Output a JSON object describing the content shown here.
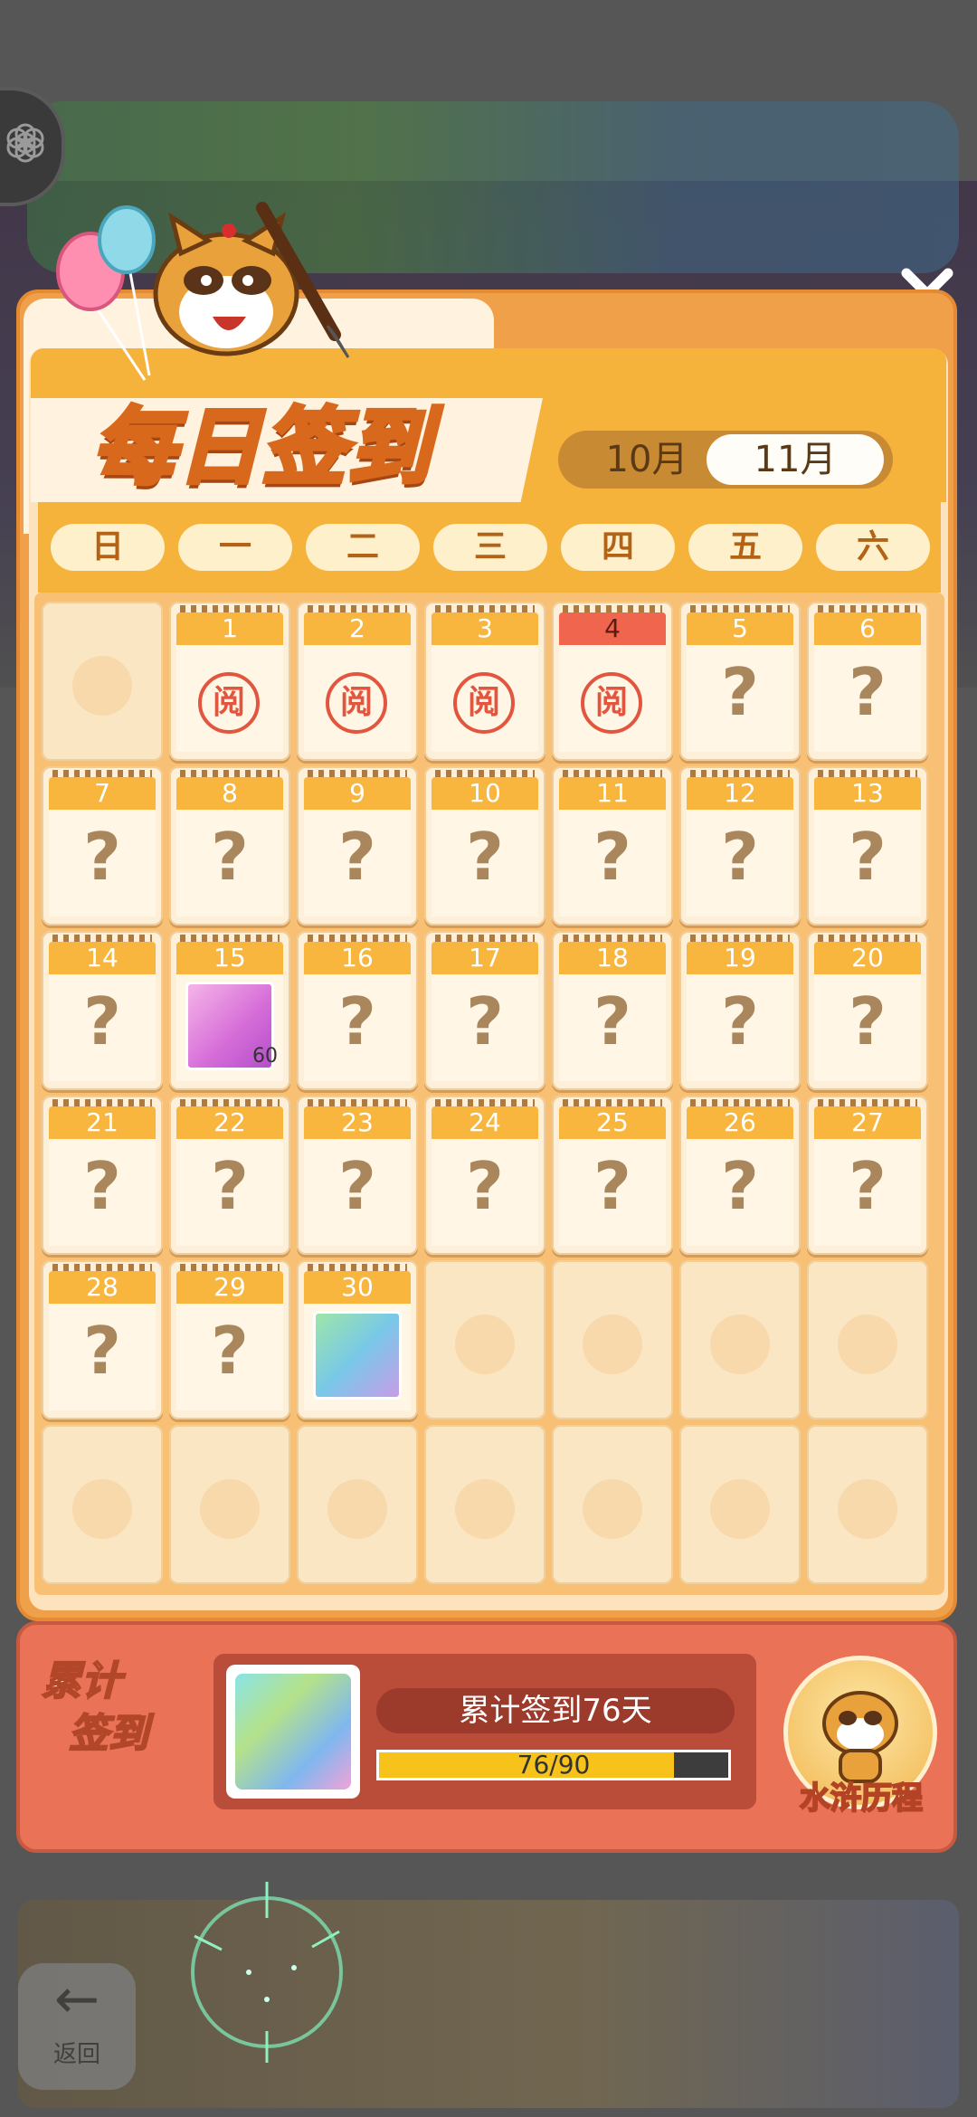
{
  "dialog": {
    "title": "每日签到",
    "close_icon": "close-icon"
  },
  "months": {
    "prev": "10月",
    "current": "11月",
    "selected": "11月"
  },
  "weekdays": [
    "日",
    "一",
    "二",
    "三",
    "四",
    "五",
    "六"
  ],
  "calendar": {
    "stamp_text": "阅",
    "unknown_text": "?",
    "today": 4,
    "days": [
      {
        "day": "1",
        "state": "signed"
      },
      {
        "day": "2",
        "state": "signed"
      },
      {
        "day": "3",
        "state": "signed"
      },
      {
        "day": "4",
        "state": "signed"
      },
      {
        "day": "5",
        "state": "unknown"
      },
      {
        "day": "6",
        "state": "unknown"
      },
      {
        "day": "7",
        "state": "unknown"
      },
      {
        "day": "8",
        "state": "unknown"
      },
      {
        "day": "9",
        "state": "unknown"
      },
      {
        "day": "10",
        "state": "unknown"
      },
      {
        "day": "11",
        "state": "unknown"
      },
      {
        "day": "12",
        "state": "unknown"
      },
      {
        "day": "13",
        "state": "unknown"
      },
      {
        "day": "14",
        "state": "unknown"
      },
      {
        "day": "15",
        "state": "reward",
        "count": "60"
      },
      {
        "day": "16",
        "state": "unknown"
      },
      {
        "day": "17",
        "state": "unknown"
      },
      {
        "day": "18",
        "state": "unknown"
      },
      {
        "day": "19",
        "state": "unknown"
      },
      {
        "day": "20",
        "state": "unknown"
      },
      {
        "day": "21",
        "state": "unknown"
      },
      {
        "day": "22",
        "state": "unknown"
      },
      {
        "day": "23",
        "state": "unknown"
      },
      {
        "day": "24",
        "state": "unknown"
      },
      {
        "day": "25",
        "state": "unknown"
      },
      {
        "day": "26",
        "state": "unknown"
      },
      {
        "day": "27",
        "state": "unknown"
      },
      {
        "day": "28",
        "state": "unknown"
      },
      {
        "day": "29",
        "state": "unknown"
      },
      {
        "day": "30",
        "state": "reward",
        "count": ""
      }
    ]
  },
  "summary": {
    "label_line1": "累计",
    "label_line2": "签到",
    "days_text": "累计签到76天",
    "progress_text": "76/90",
    "progress_value": 76,
    "progress_max": 90,
    "journey_label": "水浒历程"
  },
  "background": {
    "back_label": "返回"
  },
  "colors": {
    "accent": "#f6b33c",
    "today_tab": "#f0654e",
    "stamp": "#e2563f",
    "progress": "#f7c21a"
  }
}
